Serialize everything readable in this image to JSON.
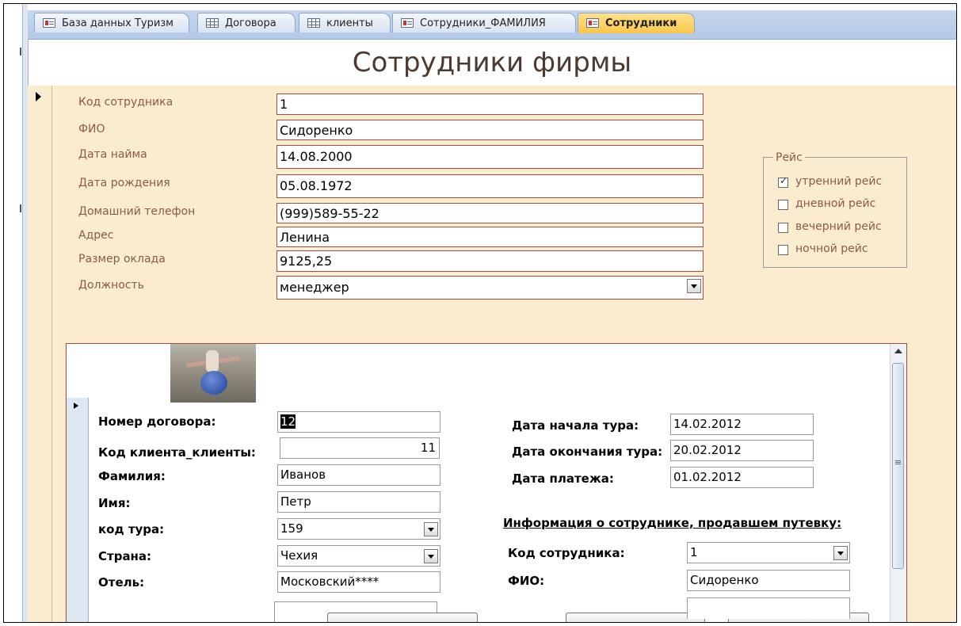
{
  "tabs": [
    {
      "label": "База данных Туризм",
      "icon": "form-icon",
      "active": false
    },
    {
      "label": "Договора",
      "icon": "table-icon",
      "active": false
    },
    {
      "label": "клиенты",
      "icon": "table-icon",
      "active": false
    },
    {
      "label": "Сотрудники_ФАМИЛИЯ",
      "icon": "form-icon",
      "active": false
    },
    {
      "label": "Сотрудники",
      "icon": "form-icon",
      "active": true
    }
  ],
  "form": {
    "title": "Сотрудники фирмы",
    "fields": [
      {
        "label": "Код сотрудника",
        "value": "1"
      },
      {
        "label": "ФИО",
        "value": "Сидоренко"
      },
      {
        "label": "Дата найма",
        "value": "14.08.2000"
      },
      {
        "label": "Дата рождения",
        "value": "05.08.1972"
      },
      {
        "label": "Домашний телефон",
        "value": "(999)589-55-22"
      },
      {
        "label": "Адрес",
        "value": "Ленина"
      },
      {
        "label": "Размер оклада",
        "value": "9125,25"
      },
      {
        "label": "Должность",
        "value": "менеджер"
      }
    ],
    "flight_group": {
      "title": "Рейс",
      "options": [
        {
          "label": "утренний рейс",
          "checked": true
        },
        {
          "label": "дневной рейс",
          "checked": false
        },
        {
          "label": "вечерний рейс",
          "checked": false
        },
        {
          "label": "ночной рейс",
          "checked": false
        }
      ]
    }
  },
  "subform": {
    "left_fields": [
      {
        "label": "Номер договора:",
        "value": "12"
      },
      {
        "label": "Код клиента_клиенты:",
        "value": "11"
      },
      {
        "label": "Фамилия:",
        "value": "Иванов"
      },
      {
        "label": "Имя:",
        "value": "Петр"
      },
      {
        "label": "код тура:",
        "value": "159"
      },
      {
        "label": "Страна:",
        "value": "Чехия"
      },
      {
        "label": "Отель:",
        "value": "Московский****"
      }
    ],
    "right_fields": [
      {
        "label": "Дата начала тура:",
        "value": "14.02.2012"
      },
      {
        "label": "Дата окончания тура:",
        "value": "20.02.2012"
      },
      {
        "label": "Дата платежа:",
        "value": "01.02.2012"
      }
    ],
    "employee_section_title": "Информация о сотруднике, продавшем путевку:",
    "employee_fields": [
      {
        "label": "Код сотрудника:",
        "value": "1"
      },
      {
        "label": "ФИО:",
        "value": "Сидоренко"
      }
    ]
  }
}
